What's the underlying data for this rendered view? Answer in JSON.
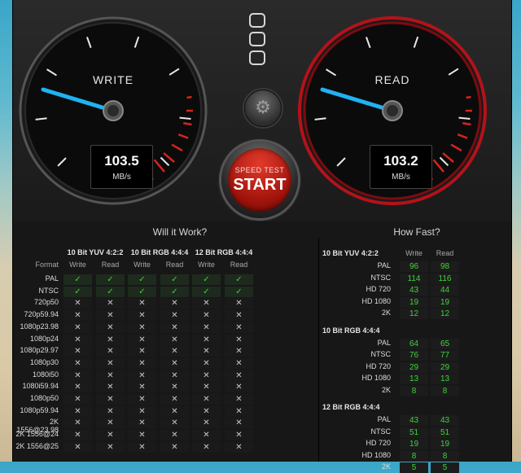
{
  "write_gauge": {
    "label": "WRITE",
    "value": "103.5",
    "unit": "MB/s"
  },
  "read_gauge": {
    "label": "READ",
    "value": "103.2",
    "unit": "MB/s"
  },
  "start_button": {
    "sub": "SPEED TEST",
    "main": "START"
  },
  "will_it_work": {
    "title": "Will it Work?",
    "format_label": "Format",
    "groups": [
      "10 Bit YUV 4:2:2",
      "10 Bit RGB 4:4:4",
      "12 Bit RGB 4:4:4"
    ],
    "sub_labels": [
      "Write",
      "Read"
    ],
    "rows": [
      {
        "name": "PAL",
        "ok": true
      },
      {
        "name": "NTSC",
        "ok": true
      },
      {
        "name": "720p50",
        "ok": false
      },
      {
        "name": "720p59.94",
        "ok": false
      },
      {
        "name": "1080p23.98",
        "ok": false
      },
      {
        "name": "1080p24",
        "ok": false
      },
      {
        "name": "1080p29.97",
        "ok": false
      },
      {
        "name": "1080p30",
        "ok": false
      },
      {
        "name": "1080i50",
        "ok": false
      },
      {
        "name": "1080i59.94",
        "ok": false
      },
      {
        "name": "1080p50",
        "ok": false
      },
      {
        "name": "1080p59.94",
        "ok": false
      },
      {
        "name": "2K 1556@23.98",
        "ok": false
      },
      {
        "name": "2K 1556@24",
        "ok": false
      },
      {
        "name": "2K 1556@25",
        "ok": false
      }
    ],
    "check_glyph": "✓",
    "cross_glyph": "✕"
  },
  "how_fast": {
    "title": "How Fast?",
    "sub_labels": [
      "Write",
      "Read"
    ],
    "sections": [
      {
        "title": "10 Bit YUV 4:2:2",
        "rows": [
          {
            "name": "PAL",
            "write": "96",
            "read": "98"
          },
          {
            "name": "NTSC",
            "write": "114",
            "read": "116"
          },
          {
            "name": "HD 720",
            "write": "43",
            "read": "44"
          },
          {
            "name": "HD 1080",
            "write": "19",
            "read": "19"
          },
          {
            "name": "2K",
            "write": "12",
            "read": "12"
          }
        ]
      },
      {
        "title": "10 Bit RGB 4:4:4",
        "rows": [
          {
            "name": "PAL",
            "write": "64",
            "read": "65"
          },
          {
            "name": "NTSC",
            "write": "76",
            "read": "77"
          },
          {
            "name": "HD 720",
            "write": "29",
            "read": "29"
          },
          {
            "name": "HD 1080",
            "write": "13",
            "read": "13"
          },
          {
            "name": "2K",
            "write": "8",
            "read": "8"
          }
        ]
      },
      {
        "title": "12 Bit RGB 4:4:4",
        "rows": [
          {
            "name": "PAL",
            "write": "43",
            "read": "43"
          },
          {
            "name": "NTSC",
            "write": "51",
            "read": "51"
          },
          {
            "name": "HD 720",
            "write": "19",
            "read": "19"
          },
          {
            "name": "HD 1080",
            "write": "8",
            "read": "8"
          },
          {
            "name": "2K",
            "write": "5",
            "read": "5"
          }
        ]
      }
    ]
  },
  "colors": {
    "accent_green": "#3fd23a",
    "needle_blue": "#1fb2f2",
    "start_red": "#c4190f",
    "read_ring_red": "#b3121a"
  }
}
